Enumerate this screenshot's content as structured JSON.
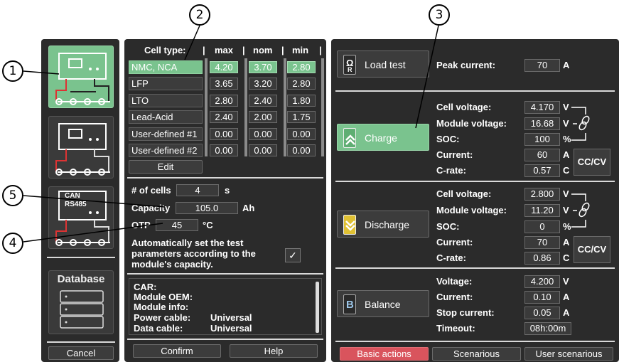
{
  "left": {
    "database_label": "Database",
    "cancel_label": "Cancel",
    "module3_can_label": "CAN",
    "module3_rs485_label": "RS485"
  },
  "cell_table": {
    "header": {
      "type": "Cell type:",
      "max": "max",
      "nom": "nom",
      "min": "min"
    },
    "rows": [
      {
        "type": "NMC, NCA",
        "max": "4.20",
        "nom": "3.70",
        "min": "2.80",
        "selected": true
      },
      {
        "type": "LFP",
        "max": "3.65",
        "nom": "3.20",
        "min": "2.80"
      },
      {
        "type": "LTO",
        "max": "2.80",
        "nom": "2.40",
        "min": "1.80"
      },
      {
        "type": "Lead-Acid",
        "max": "2.40",
        "nom": "2.00",
        "min": "1.75"
      },
      {
        "type": "User-defined #1",
        "max": "0.00",
        "nom": "0.00",
        "min": "0.00"
      },
      {
        "type": "User-defined #2",
        "max": "0.00",
        "nom": "0.00",
        "min": "0.00"
      }
    ],
    "edit_label": "Edit"
  },
  "module_params": {
    "cells_label": "# of cells",
    "cells_value": "4",
    "cells_unit": "s",
    "capacity_label": "Capacity",
    "capacity_value": "105.0",
    "capacity_unit": "Ah",
    "otp_label": "OTP",
    "otp_value": "45",
    "otp_unit": "°C",
    "auto_text": "Automatically set the test parameters according to the module's capacity.",
    "auto_checked": "✓"
  },
  "module_info": {
    "car_label": "CAR:",
    "oem_label": "Module OEM:",
    "info_label": "Module info:",
    "power_cable_label": "Power cable:",
    "power_cable_value": "Universal",
    "data_cable_label": "Data cable:",
    "data_cable_value": "Universal"
  },
  "bottom_mid": {
    "confirm_label": "Confirm",
    "help_label": "Help"
  },
  "load_test": {
    "button_label": "Load test",
    "peak_label": "Peak current:",
    "peak_value": "70",
    "peak_unit": "A",
    "icon_letter": "Ω",
    "icon_sub": "R"
  },
  "charge": {
    "button_label": "Charge",
    "cell_voltage_label": "Cell voltage:",
    "cell_voltage_value": "4.170",
    "cell_voltage_unit": "V",
    "module_voltage_label": "Module voltage:",
    "module_voltage_value": "16.68",
    "module_voltage_unit": "V",
    "soc_label": "SOC:",
    "soc_value": "100",
    "soc_unit": "%",
    "current_label": "Current:",
    "current_value": "60",
    "current_unit": "A",
    "crate_label": "C-rate:",
    "crate_value": "0.57",
    "crate_unit": "C",
    "mode_label": "CC/CV"
  },
  "discharge": {
    "button_label": "Discharge",
    "cell_voltage_label": "Cell voltage:",
    "cell_voltage_value": "2.800",
    "cell_voltage_unit": "V",
    "module_voltage_label": "Module voltage:",
    "module_voltage_value": "11.20",
    "module_voltage_unit": "V",
    "soc_label": "SOC:",
    "soc_value": "0",
    "soc_unit": "%",
    "current_label": "Current:",
    "current_value": "70",
    "current_unit": "A",
    "crate_label": "C-rate:",
    "crate_value": "0.86",
    "crate_unit": "C",
    "mode_label": "CC/CV"
  },
  "balance": {
    "button_label": "Balance",
    "icon_letter": "B",
    "voltage_label": "Voltage:",
    "voltage_value": "4.200",
    "voltage_unit": "V",
    "current_label": "Current:",
    "current_value": "0.10",
    "current_unit": "A",
    "stop_label": "Stop current:",
    "stop_value": "0.05",
    "stop_unit": "A",
    "timeout_label": "Timeout:",
    "timeout_value": "08h:00m"
  },
  "tabs": {
    "basic": "Basic actions",
    "scenarious": "Scenarious",
    "user_scenarious": "User scenarious"
  },
  "callouts": [
    "1",
    "2",
    "3",
    "4",
    "5"
  ],
  "colors": {
    "panel": "#2b2b2b",
    "selected_green": "#7ac38e",
    "active_tab_red": "#d9545d"
  }
}
